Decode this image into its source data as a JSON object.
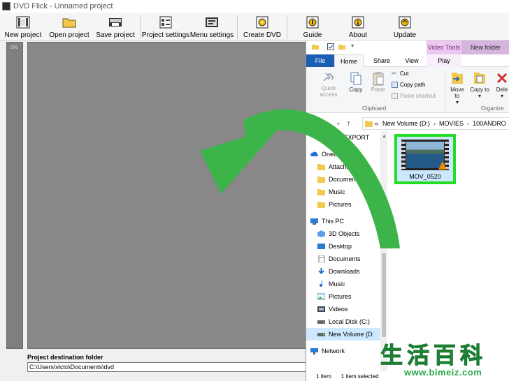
{
  "dvdflick": {
    "title": "DVD Flick - Unnamed project",
    "toolbar": [
      {
        "label": "New project",
        "icon": "new-project-icon"
      },
      {
        "label": "Open project",
        "icon": "open-folder-icon"
      },
      {
        "label": "Save project",
        "icon": "save-project-icon"
      },
      {
        "label": "Project settings",
        "icon": "project-settings-icon"
      },
      {
        "label": "Menu settings",
        "icon": "menu-settings-icon"
      },
      {
        "label": "Create DVD",
        "icon": "create-dvd-icon"
      },
      {
        "label": "Guide",
        "icon": "guide-icon"
      },
      {
        "label": "About",
        "icon": "about-icon"
      },
      {
        "label": "Update",
        "icon": "update-icon"
      }
    ],
    "progress_label": "0%",
    "destination_label": "Project destination folder",
    "destination_value": "C:\\Users\\victo\\Documents\\dvd"
  },
  "explorer": {
    "context_tab": "Video Tools",
    "window_title": "New folder",
    "tabs": [
      "File",
      "Home",
      "Share",
      "View",
      "Play"
    ],
    "ribbon": {
      "pin_label": "Quick access",
      "copy_label": "Copy",
      "paste_label": "Paste",
      "cut_label": "Cut",
      "copy_path_label": "Copy path",
      "paste_shortcut_label": "Paste shortcut",
      "clipboard_group": "Clipboard",
      "move_to_label": "Move to",
      "copy_to_label": "Copy to",
      "delete_label": "Dele",
      "organize_group": "Organize"
    },
    "address": {
      "prefix": "«",
      "segments": [
        "New Volume (D:)",
        "MOVIES",
        "100ANDRO"
      ]
    },
    "nav_items": [
      {
        "label": "FOR EXPORT",
        "icon": "folder-icon"
      },
      {
        "label": "OneDrive",
        "icon": "onedrive-icon"
      },
      {
        "label": "Attachments",
        "icon": "folder-icon"
      },
      {
        "label": "Documents",
        "icon": "folder-icon"
      },
      {
        "label": "Music",
        "icon": "folder-icon"
      },
      {
        "label": "Pictures",
        "icon": "folder-icon"
      },
      {
        "label": "This PC",
        "icon": "pc-icon"
      },
      {
        "label": "3D Objects",
        "icon": "3d-objects-icon"
      },
      {
        "label": "Desktop",
        "icon": "desktop-icon"
      },
      {
        "label": "Documents",
        "icon": "documents-icon"
      },
      {
        "label": "Downloads",
        "icon": "downloads-icon"
      },
      {
        "label": "Music",
        "icon": "music-icon"
      },
      {
        "label": "Pictures",
        "icon": "pictures-icon"
      },
      {
        "label": "Videos",
        "icon": "videos-icon"
      },
      {
        "label": "Local Disk (C:)",
        "icon": "drive-icon"
      },
      {
        "label": "New Volume (D:",
        "icon": "drive-icon",
        "selected": true
      },
      {
        "label": "Network",
        "icon": "network-icon"
      }
    ],
    "file": {
      "name": "MOV_0520",
      "icon": "video-file-icon"
    },
    "status": {
      "count": "1 item",
      "selected": "1 item selected"
    }
  },
  "watermark": {
    "chars": [
      "生",
      "活",
      "百",
      "科"
    ],
    "url": "www.bimeiz.com"
  },
  "colors": {
    "arrow": "#3cb44a",
    "highlight": "#22dd22",
    "file_tab": "#1a5fb4",
    "context_tab": "#ebc8f0"
  }
}
